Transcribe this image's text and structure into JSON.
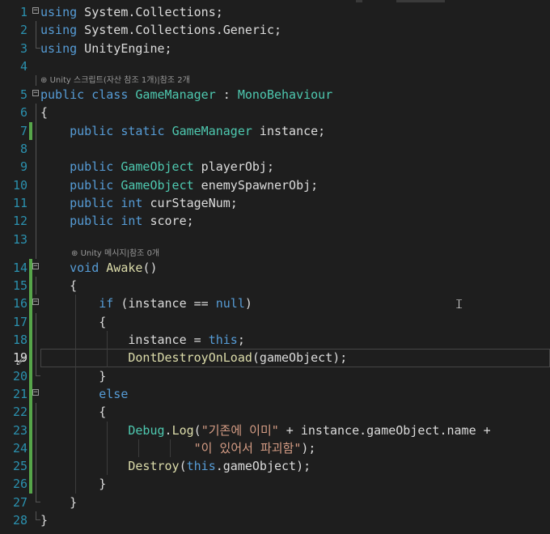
{
  "lines": [
    {
      "n": "1",
      "tokens": [
        {
          "t": "using",
          "c": "kw"
        },
        {
          "t": " System.Collections;",
          "c": "pl"
        }
      ]
    },
    {
      "n": "2",
      "tokens": [
        {
          "t": "using",
          "c": "kw"
        },
        {
          "t": " System.Collections.Generic;",
          "c": "pl"
        }
      ]
    },
    {
      "n": "3",
      "tokens": [
        {
          "t": "using",
          "c": "kw"
        },
        {
          "t": " UnityEngine;",
          "c": "pl"
        }
      ]
    },
    {
      "n": "4",
      "tokens": []
    },
    {
      "lens": "Unity 스크립트(자산 참조 1개)|참조 2개"
    },
    {
      "n": "5",
      "tokens": [
        {
          "t": "public",
          "c": "kw"
        },
        {
          "t": " ",
          "c": "pl"
        },
        {
          "t": "class",
          "c": "kw"
        },
        {
          "t": " ",
          "c": "pl"
        },
        {
          "t": "GameManager",
          "c": "ty"
        },
        {
          "t": " : ",
          "c": "pl"
        },
        {
          "t": "MonoBehaviour",
          "c": "ty"
        }
      ]
    },
    {
      "n": "6",
      "tokens": [
        {
          "t": "{",
          "c": "pl"
        }
      ]
    },
    {
      "n": "7",
      "tokens": [
        {
          "t": "    ",
          "c": "pl"
        },
        {
          "t": "public",
          "c": "kw"
        },
        {
          "t": " ",
          "c": "pl"
        },
        {
          "t": "static",
          "c": "kw"
        },
        {
          "t": " ",
          "c": "pl"
        },
        {
          "t": "GameManager",
          "c": "ty"
        },
        {
          "t": " instance;",
          "c": "pl"
        }
      ]
    },
    {
      "n": "8",
      "tokens": []
    },
    {
      "n": "9",
      "tokens": [
        {
          "t": "    ",
          "c": "pl"
        },
        {
          "t": "public",
          "c": "kw"
        },
        {
          "t": " ",
          "c": "pl"
        },
        {
          "t": "GameObject",
          "c": "ty"
        },
        {
          "t": " playerObj;",
          "c": "pl"
        }
      ]
    },
    {
      "n": "10",
      "tokens": [
        {
          "t": "    ",
          "c": "pl"
        },
        {
          "t": "public",
          "c": "kw"
        },
        {
          "t": " ",
          "c": "pl"
        },
        {
          "t": "GameObject",
          "c": "ty"
        },
        {
          "t": " enemySpawnerObj;",
          "c": "pl"
        }
      ]
    },
    {
      "n": "11",
      "tokens": [
        {
          "t": "    ",
          "c": "pl"
        },
        {
          "t": "public",
          "c": "kw"
        },
        {
          "t": " ",
          "c": "pl"
        },
        {
          "t": "int",
          "c": "kw"
        },
        {
          "t": " curStageNum;",
          "c": "pl"
        }
      ]
    },
    {
      "n": "12",
      "tokens": [
        {
          "t": "    ",
          "c": "pl"
        },
        {
          "t": "public",
          "c": "kw"
        },
        {
          "t": " ",
          "c": "pl"
        },
        {
          "t": "int",
          "c": "kw"
        },
        {
          "t": " score;",
          "c": "pl"
        }
      ]
    },
    {
      "n": "13",
      "tokens": []
    },
    {
      "lens": "Unity 메시지|참조 0개"
    },
    {
      "n": "14",
      "tokens": [
        {
          "t": "    ",
          "c": "pl"
        },
        {
          "t": "void",
          "c": "kw"
        },
        {
          "t": " ",
          "c": "pl"
        },
        {
          "t": "Awake",
          "c": "me"
        },
        {
          "t": "()",
          "c": "pl"
        }
      ]
    },
    {
      "n": "15",
      "tokens": [
        {
          "t": "    {",
          "c": "pl"
        }
      ]
    },
    {
      "n": "16",
      "tokens": [
        {
          "t": "        ",
          "c": "pl"
        },
        {
          "t": "if",
          "c": "kw"
        },
        {
          "t": " (instance == ",
          "c": "pl"
        },
        {
          "t": "null",
          "c": "kw"
        },
        {
          "t": ")",
          "c": "pl"
        }
      ]
    },
    {
      "n": "17",
      "tokens": [
        {
          "t": "        {",
          "c": "pl"
        }
      ]
    },
    {
      "n": "18",
      "tokens": [
        {
          "t": "            instance = ",
          "c": "pl"
        },
        {
          "t": "this",
          "c": "kw"
        },
        {
          "t": ";",
          "c": "pl"
        }
      ]
    },
    {
      "n": "19",
      "tokens": [
        {
          "t": "            ",
          "c": "pl"
        },
        {
          "t": "DontDestroyOnLoad",
          "c": "me"
        },
        {
          "t": "(gameObject);",
          "c": "pl"
        }
      ]
    },
    {
      "n": "20",
      "tokens": [
        {
          "t": "        }",
          "c": "pl"
        }
      ]
    },
    {
      "n": "21",
      "tokens": [
        {
          "t": "        ",
          "c": "pl"
        },
        {
          "t": "else",
          "c": "kw"
        }
      ]
    },
    {
      "n": "22",
      "tokens": [
        {
          "t": "        {",
          "c": "pl"
        }
      ]
    },
    {
      "n": "23",
      "tokens": [
        {
          "t": "            ",
          "c": "pl"
        },
        {
          "t": "Debug",
          "c": "ty"
        },
        {
          "t": ".",
          "c": "pl"
        },
        {
          "t": "Log",
          "c": "me"
        },
        {
          "t": "(",
          "c": "pl"
        },
        {
          "t": "\"기존에 이미\"",
          "c": "st"
        },
        {
          "t": " + instance.gameObject.name +",
          "c": "pl"
        }
      ]
    },
    {
      "n": "24",
      "tokens": [
        {
          "t": "                     ",
          "c": "pl"
        },
        {
          "t": "\"이 있어서 파괴함\"",
          "c": "st"
        },
        {
          "t": ");",
          "c": "pl"
        }
      ]
    },
    {
      "n": "25",
      "tokens": [
        {
          "t": "            ",
          "c": "pl"
        },
        {
          "t": "Destroy",
          "c": "me"
        },
        {
          "t": "(",
          "c": "pl"
        },
        {
          "t": "this",
          "c": "kw"
        },
        {
          "t": ".gameObject);",
          "c": "pl"
        }
      ]
    },
    {
      "n": "26",
      "tokens": [
        {
          "t": "        }",
          "c": "pl"
        }
      ]
    },
    {
      "n": "27",
      "tokens": [
        {
          "t": "    }",
          "c": "pl"
        }
      ]
    },
    {
      "n": "28",
      "tokens": [
        {
          "t": "}",
          "c": "pl"
        }
      ]
    }
  ],
  "current_line": "19",
  "colors": {
    "background": "#1e1e1e",
    "keyword": "#569cd6",
    "type": "#4ec9b0",
    "method": "#dcdcaa",
    "string": "#d69d85",
    "line_number": "#2b91af",
    "change_marker": "#57a64a"
  },
  "icons": {
    "lens": "unity-icon",
    "gutter": "paintbrush-icon",
    "pointer": "text-cursor-icon"
  }
}
